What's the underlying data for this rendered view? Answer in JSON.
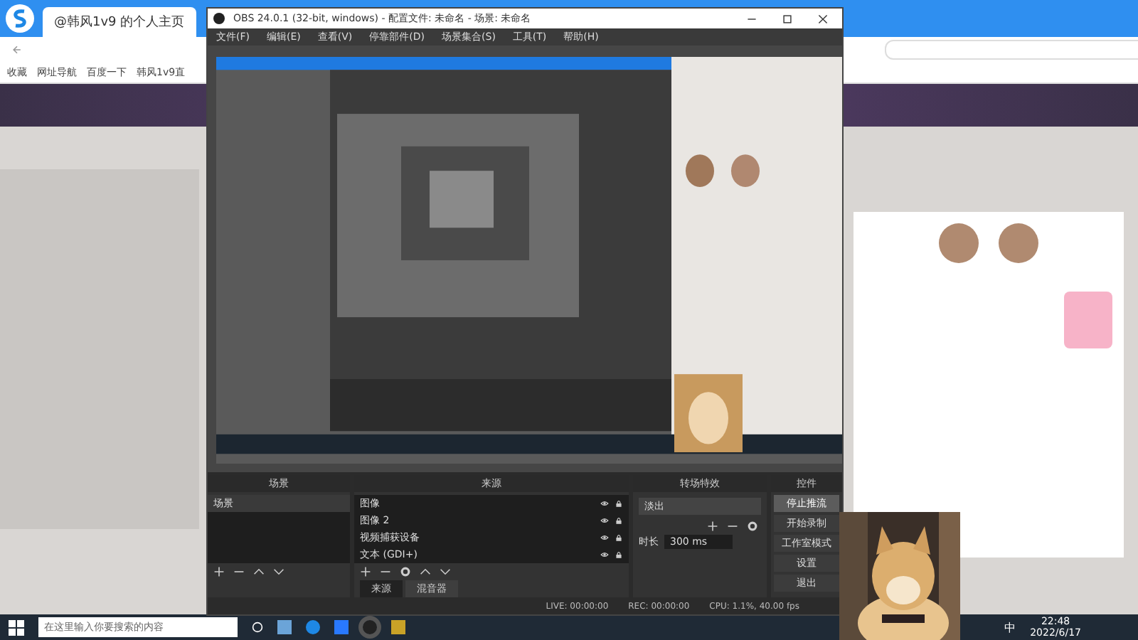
{
  "browser": {
    "tabs": [
      {
        "label": "@韩风1v9 的个人主页",
        "selected": true
      }
    ],
    "bookmarks": [
      "收藏",
      "网址导航",
      "百度一下",
      "韩风1v9直"
    ]
  },
  "obs": {
    "title": "OBS 24.0.1 (32-bit, windows) - 配置文件: 未命名 - 场景: 未命名",
    "menu": [
      "文件(F)",
      "编辑(E)",
      "查看(V)",
      "停靠部件(D)",
      "场景集合(S)",
      "工具(T)",
      "帮助(H)"
    ],
    "scenes": {
      "title": "场景",
      "items": [
        {
          "label": "场景",
          "selected": true
        }
      ]
    },
    "sources": {
      "title": "来源",
      "items": [
        {
          "label": "图像"
        },
        {
          "label": "图像 2"
        },
        {
          "label": "视频捕获设备"
        },
        {
          "label": "文本 (GDI+)"
        }
      ]
    },
    "dock_tabs": [
      {
        "label": "来源",
        "selected": true
      },
      {
        "label": "混音器",
        "selected": false
      }
    ],
    "transitions": {
      "title": "转场特效",
      "transition": "淡出",
      "duration_label": "时长",
      "duration": "300 ms"
    },
    "controls": {
      "title": "控件",
      "buttons": [
        {
          "label": "停止推流",
          "active": true
        },
        {
          "label": "开始录制",
          "active": false
        },
        {
          "label": "工作室模式",
          "active": false
        },
        {
          "label": "设置",
          "active": false
        },
        {
          "label": "退出",
          "active": false
        }
      ]
    },
    "status": [
      "LIVE: 00:00:00",
      "REC: 00:00:00",
      "CPU: 1.1%, 40.00 fps"
    ]
  },
  "taskbar": {
    "search": {
      "placeholder": "在这里输入你要搜索的内容"
    },
    "ime": "中",
    "time": "22:48",
    "date": "2022/6/17"
  }
}
